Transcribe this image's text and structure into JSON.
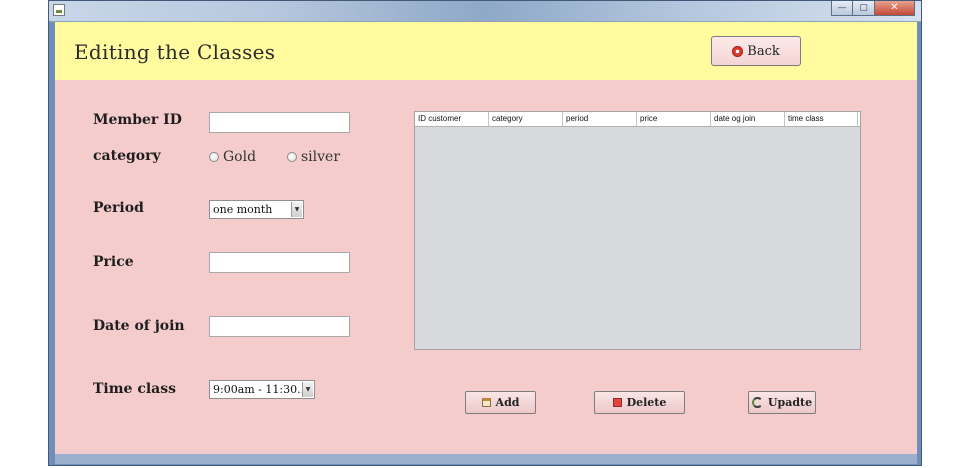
{
  "window": {
    "controls": {
      "minimize": "—",
      "maximize": "▢",
      "close": "✕"
    }
  },
  "header": {
    "title": "Editing the Classes",
    "back_label": "Back",
    "back_icon": "back-icon"
  },
  "form": {
    "member_id": {
      "label": "Member ID",
      "value": ""
    },
    "category": {
      "label": "category",
      "options": [
        "Gold",
        "silver"
      ],
      "selected": null
    },
    "period": {
      "label": "Period",
      "selected": "one month"
    },
    "price": {
      "label": "Price",
      "value": ""
    },
    "date_of_join": {
      "label": "Date of join",
      "value": ""
    },
    "time_class": {
      "label": "Time class",
      "selected": "9:00am - 11:30..."
    }
  },
  "table": {
    "columns": [
      "ID customer",
      "category",
      "period",
      "price",
      "date og join",
      "time class"
    ],
    "rows": []
  },
  "actions": {
    "add": "Add",
    "delete": "Delete",
    "update": "Upadte"
  },
  "colors": {
    "header_bg": "#fffb9e",
    "content_bg": "#f5cccc",
    "table_bg": "#d8d9dc"
  }
}
